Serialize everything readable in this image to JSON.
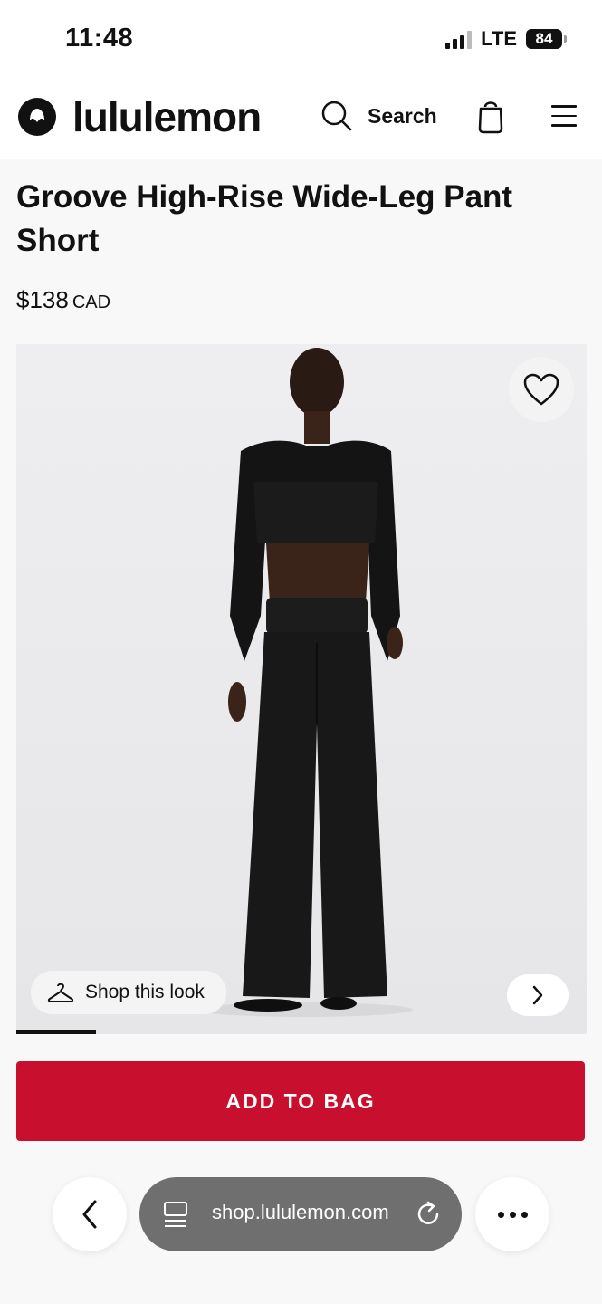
{
  "status_bar": {
    "time": "11:48",
    "network": "LTE",
    "battery": "84"
  },
  "header": {
    "brand": "lululemon",
    "search_label": "Search"
  },
  "product": {
    "title": "Groove High-Rise Wide-Leg Pant Short",
    "price": "$138",
    "currency": "CAD",
    "shop_look_label": "Shop this look",
    "gallery_progress": 0.14
  },
  "actions": {
    "add_to_bag": "ADD TO BAG"
  },
  "browser": {
    "url": "shop.lululemon.com"
  },
  "colors": {
    "accent": "#c8102e",
    "text": "#111111",
    "page_background": "#f8f8f8"
  },
  "icons": [
    "lululemon-logo-icon",
    "search-icon",
    "shopping-bag-icon",
    "menu-icon",
    "heart-icon",
    "hanger-icon",
    "chevron-right-icon",
    "chevron-left-icon",
    "tabs-icon",
    "reload-icon",
    "more-icon"
  ]
}
